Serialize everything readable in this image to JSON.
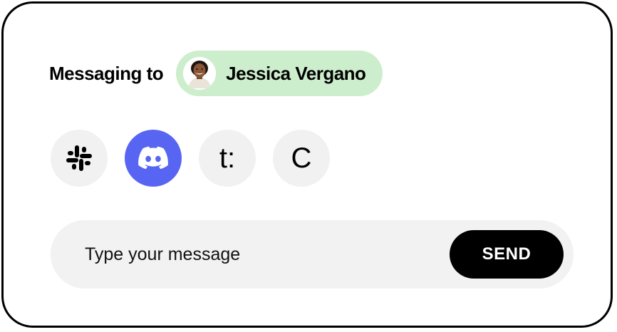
{
  "header": {
    "prefix": "Messaging to",
    "recipient": {
      "name": "Jessica Vergano",
      "chip_color": "#cdeecd"
    }
  },
  "channels": [
    {
      "icon": "slack-icon",
      "active": false
    },
    {
      "icon": "discord-icon",
      "active": true,
      "color": "#5865f2"
    },
    {
      "icon": "teams-t-icon",
      "glyph": "t:",
      "active": false
    },
    {
      "icon": "c-icon",
      "glyph": "C",
      "active": false
    }
  ],
  "composer": {
    "placeholder": "Type your message",
    "send_label": "SEND"
  }
}
